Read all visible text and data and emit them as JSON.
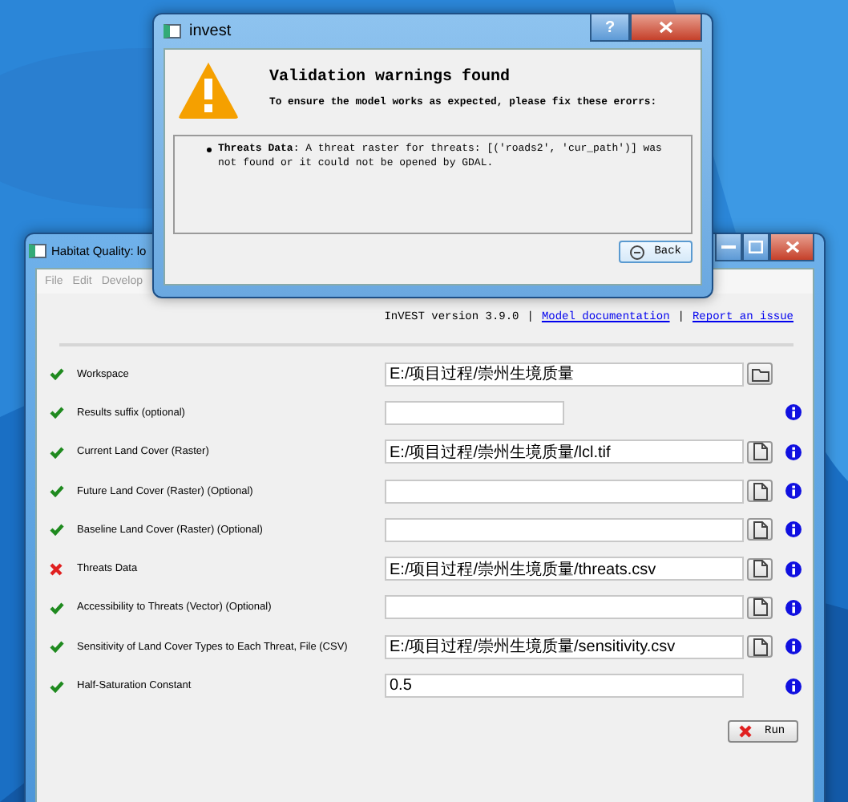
{
  "main_window": {
    "title": "Habitat Quality: lo",
    "menu": [
      "File",
      "Edit",
      "Develop"
    ],
    "header": [
      {
        "kind": "text",
        "text": "InVEST version 3.9.0"
      },
      {
        "kind": "separator",
        "text": "|"
      },
      {
        "kind": "link",
        "text": "Model documentation"
      },
      {
        "kind": "separator",
        "text": "|"
      },
      {
        "kind": "link",
        "text": "Report an issue"
      }
    ],
    "rows": [
      {
        "label": "Workspace",
        "valid": true,
        "value": "E:/项目过程/崇州生境质量",
        "kind": "folder",
        "info": false
      },
      {
        "label": "Results suffix (optional)",
        "valid": true,
        "kind": "short",
        "info": true
      },
      {
        "label": "Current Land Cover (Raster)",
        "valid": true,
        "value": "E:/项目过程/崇州生境质量/lcl.tif",
        "kind": "file",
        "info": true
      },
      {
        "label": "Future Land Cover (Raster) (Optional)",
        "valid": true,
        "kind": "file",
        "info": true
      },
      {
        "label": "Baseline Land Cover (Raster) (Optional)",
        "valid": true,
        "kind": "file",
        "info": true
      },
      {
        "label": "Threats Data",
        "valid": false,
        "value": "E:/项目过程/崇州生境质量/threats.csv",
        "kind": "file",
        "info": true
      },
      {
        "label": "Accessibility to Threats (Vector) (Optional)",
        "valid": true,
        "kind": "file",
        "info": true
      },
      {
        "label": "Sensitivity of Land Cover Types to Each Threat, File (CSV)",
        "valid": true,
        "value": "E:/项目过程/崇州生境质量/sensitivity.csv",
        "kind": "file",
        "info": true
      },
      {
        "label": "Half-Saturation Constant",
        "valid": true,
        "value": "0.5",
        "kind": "plain",
        "info": true
      }
    ],
    "run_button": "Run"
  },
  "dialog": {
    "title": "invest",
    "help_button": "?",
    "heading": "Validation warnings found",
    "subheading": "To ensure the model works as expected, please fix these erorrs:",
    "messages": [
      "**Threats Data**: A threat raster for threats: [('roads2', 'cur_path')] was not found or it could not be opened by GDAL."
    ],
    "back_button": "Back"
  }
}
